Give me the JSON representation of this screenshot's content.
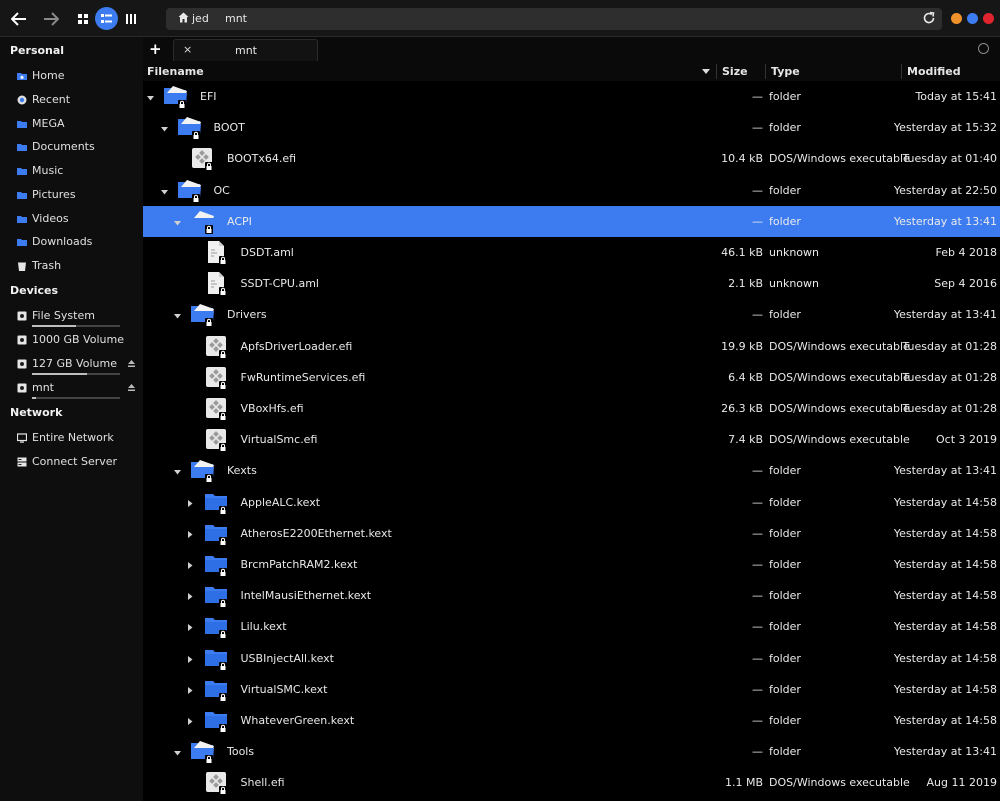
{
  "path": {
    "home": "jed",
    "current": "mnt"
  },
  "window_dots": [
    "#f0912c",
    "#3d7cf0",
    "#e0242f"
  ],
  "sidebar": {
    "personal_title": "Personal",
    "personal": [
      {
        "label": "Home",
        "icon": "home-folder-icon"
      },
      {
        "label": "Recent",
        "icon": "recent-icon"
      },
      {
        "label": "MEGA",
        "icon": "folder-icon"
      },
      {
        "label": "Documents",
        "icon": "folder-icon"
      },
      {
        "label": "Music",
        "icon": "folder-icon"
      },
      {
        "label": "Pictures",
        "icon": "folder-icon"
      },
      {
        "label": "Videos",
        "icon": "folder-icon"
      },
      {
        "label": "Downloads",
        "icon": "folder-icon"
      },
      {
        "label": "Trash",
        "icon": "trash-icon"
      }
    ],
    "devices_title": "Devices",
    "devices": [
      {
        "label": "File System",
        "usage": 0.5,
        "eject": false
      },
      {
        "label": "1000 GB Volume",
        "eject": false
      },
      {
        "label": "127 GB Volume",
        "usage": 0.62,
        "eject": true
      },
      {
        "label": "mnt",
        "usage": 0.05,
        "eject": true
      }
    ],
    "network_title": "Network",
    "network": [
      {
        "label": "Entire Network",
        "icon": "network-icon"
      },
      {
        "label": "Connect Server",
        "icon": "server-icon"
      }
    ]
  },
  "tab": {
    "add": "+",
    "close": "×",
    "label": "mnt"
  },
  "columns": {
    "filename": "Filename",
    "size": "Size",
    "type": "Type",
    "modified": "Modified"
  },
  "rows": [
    {
      "name": "EFI",
      "depth": 0,
      "kind": "folder",
      "expanded": true,
      "size": "—",
      "type": "folder",
      "modified": "Today at 15:41"
    },
    {
      "name": "BOOT",
      "depth": 1,
      "kind": "folder",
      "expanded": true,
      "size": "—",
      "type": "folder",
      "modified": "Yesterday at 15:32"
    },
    {
      "name": "BOOTx64.efi",
      "depth": 2,
      "kind": "exe",
      "size": "10.4 kB",
      "type": "DOS/Windows executable",
      "modified": "Tuesday at 01:40"
    },
    {
      "name": "OC",
      "depth": 1,
      "kind": "folder",
      "expanded": true,
      "size": "—",
      "type": "folder",
      "modified": "Yesterday at 22:50"
    },
    {
      "name": "ACPI",
      "depth": 2,
      "kind": "folder",
      "expanded": true,
      "selected": true,
      "size": "—",
      "type": "folder",
      "modified": "Yesterday at 13:41"
    },
    {
      "name": "DSDT.aml",
      "depth": 3,
      "kind": "text",
      "size": "46.1 kB",
      "type": "unknown",
      "modified": "Feb  4 2018"
    },
    {
      "name": "SSDT-CPU.aml",
      "depth": 3,
      "kind": "text",
      "size": "2.1 kB",
      "type": "unknown",
      "modified": "Sep  4 2016"
    },
    {
      "name": "Drivers",
      "depth": 2,
      "kind": "folder",
      "expanded": true,
      "size": "—",
      "type": "folder",
      "modified": "Yesterday at 13:41"
    },
    {
      "name": "ApfsDriverLoader.efi",
      "depth": 3,
      "kind": "exe",
      "size": "19.9 kB",
      "type": "DOS/Windows executable",
      "modified": "Tuesday at 01:28"
    },
    {
      "name": "FwRuntimeServices.efi",
      "depth": 3,
      "kind": "exe",
      "size": "6.4 kB",
      "type": "DOS/Windows executable",
      "modified": "Tuesday at 01:28"
    },
    {
      "name": "VBoxHfs.efi",
      "depth": 3,
      "kind": "exe",
      "size": "26.3 kB",
      "type": "DOS/Windows executable",
      "modified": "Tuesday at 01:28"
    },
    {
      "name": "VirtualSmc.efi",
      "depth": 3,
      "kind": "exe",
      "size": "7.4 kB",
      "type": "DOS/Windows executable",
      "modified": "Oct  3 2019"
    },
    {
      "name": "Kexts",
      "depth": 2,
      "kind": "folder",
      "expanded": true,
      "size": "—",
      "type": "folder",
      "modified": "Yesterday at 13:41"
    },
    {
      "name": "AppleALC.kext",
      "depth": 3,
      "kind": "folder-closed",
      "expanded": false,
      "size": "—",
      "type": "folder",
      "modified": "Yesterday at 14:58"
    },
    {
      "name": "AtherosE2200Ethernet.kext",
      "depth": 3,
      "kind": "folder-closed",
      "expanded": false,
      "size": "—",
      "type": "folder",
      "modified": "Yesterday at 14:58"
    },
    {
      "name": "BrcmPatchRAM2.kext",
      "depth": 3,
      "kind": "folder-closed",
      "expanded": false,
      "size": "—",
      "type": "folder",
      "modified": "Yesterday at 14:58"
    },
    {
      "name": "IntelMausiEthernet.kext",
      "depth": 3,
      "kind": "folder-closed",
      "expanded": false,
      "size": "—",
      "type": "folder",
      "modified": "Yesterday at 14:58"
    },
    {
      "name": "Lilu.kext",
      "depth": 3,
      "kind": "folder-closed",
      "expanded": false,
      "size": "—",
      "type": "folder",
      "modified": "Yesterday at 14:58"
    },
    {
      "name": "USBInjectAll.kext",
      "depth": 3,
      "kind": "folder-closed",
      "expanded": false,
      "size": "—",
      "type": "folder",
      "modified": "Yesterday at 14:58"
    },
    {
      "name": "VirtualSMC.kext",
      "depth": 3,
      "kind": "folder-closed",
      "expanded": false,
      "size": "—",
      "type": "folder",
      "modified": "Yesterday at 14:58"
    },
    {
      "name": "WhateverGreen.kext",
      "depth": 3,
      "kind": "folder-closed",
      "expanded": false,
      "size": "—",
      "type": "folder",
      "modified": "Yesterday at 14:58"
    },
    {
      "name": "Tools",
      "depth": 2,
      "kind": "folder",
      "expanded": true,
      "size": "—",
      "type": "folder",
      "modified": "Yesterday at 13:41"
    },
    {
      "name": "Shell.efi",
      "depth": 3,
      "kind": "exe",
      "size": "1.1 MB",
      "type": "DOS/Windows executable",
      "modified": "Aug 11 2019"
    }
  ]
}
